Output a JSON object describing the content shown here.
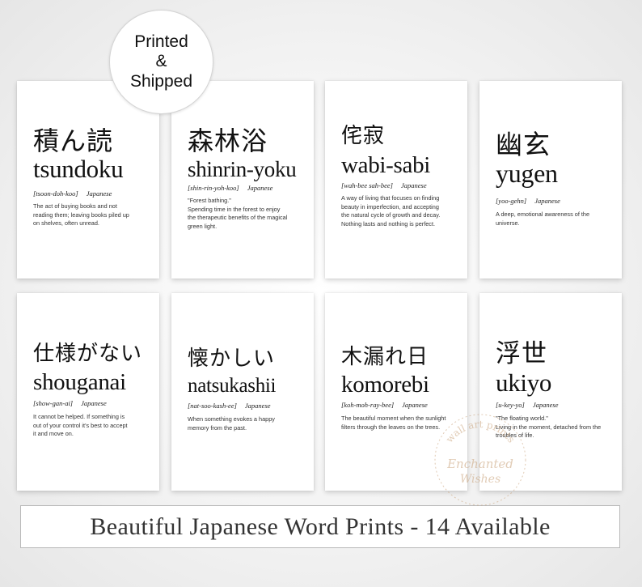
{
  "badge": {
    "line1": "Printed",
    "line2": "&",
    "line3": "Shipped"
  },
  "cards": [
    {
      "kanji": "積ん読",
      "word": "tsundoku",
      "pron": "[tsoon-doh-koo]",
      "lang": "Japanese",
      "def": [
        "The act of buying books and not",
        "reading them; leaving books piled up",
        "on shelves, often unread."
      ]
    },
    {
      "kanji": "森林浴",
      "word": "shinrin-yoku",
      "pron": "[shin-rin-yoh-koo]",
      "lang": "Japanese",
      "def": [
        "\"Forest bathing.\"",
        "Spending time in the forest to enjoy",
        "the therapeutic benefits of the magical",
        "green light."
      ]
    },
    {
      "kanji": "侘寂",
      "word": "wabi-sabi",
      "pron": "[wah-bee sah-bee]",
      "lang": "Japanese",
      "def": [
        "A way of living that focuses on finding",
        "beauty in imperfection, and accepting",
        "the natural cycle of growth and decay.",
        "Nothing lasts and nothing is perfect."
      ]
    },
    {
      "kanji": "幽玄",
      "word": "yugen",
      "pron": "[yoo-gehn]",
      "lang": "Japanese",
      "def": [
        "A deep, emotional awareness of the",
        "universe."
      ]
    },
    {
      "kanji": "仕様がない",
      "word": "shouganai",
      "pron": "[show-gan-ai]",
      "lang": "Japanese",
      "def": [
        "It cannot be helped. If something is",
        "out of your control it's best to accept",
        "it and move on."
      ]
    },
    {
      "kanji": "懐かしい",
      "word": "natsukashii",
      "pron": "[nat-soo-kash-ee]",
      "lang": "Japanese",
      "def": [
        "When something evokes a happy",
        "memory from the past."
      ]
    },
    {
      "kanji": "木漏れ日",
      "word": "komorebi",
      "pron": "[koh-moh-ray-bee]",
      "lang": "Japanese",
      "def": [
        "The beautiful moment when the sunlight",
        "filters through the leaves on the trees."
      ]
    },
    {
      "kanji": "浮世",
      "word": "ukiyo",
      "pron": "[u-key-yo]",
      "lang": "Japanese",
      "def": [
        "\"The floating world.\"",
        "Living in the moment, detached from the",
        "troubles of life."
      ]
    }
  ],
  "watermark": {
    "line1": "wall art prints",
    "line2": "Enchanted",
    "line3": "Wishes",
    "color": "#c9a27a"
  },
  "banner": {
    "text": "Beautiful Japanese Word Prints - 14 Available"
  }
}
